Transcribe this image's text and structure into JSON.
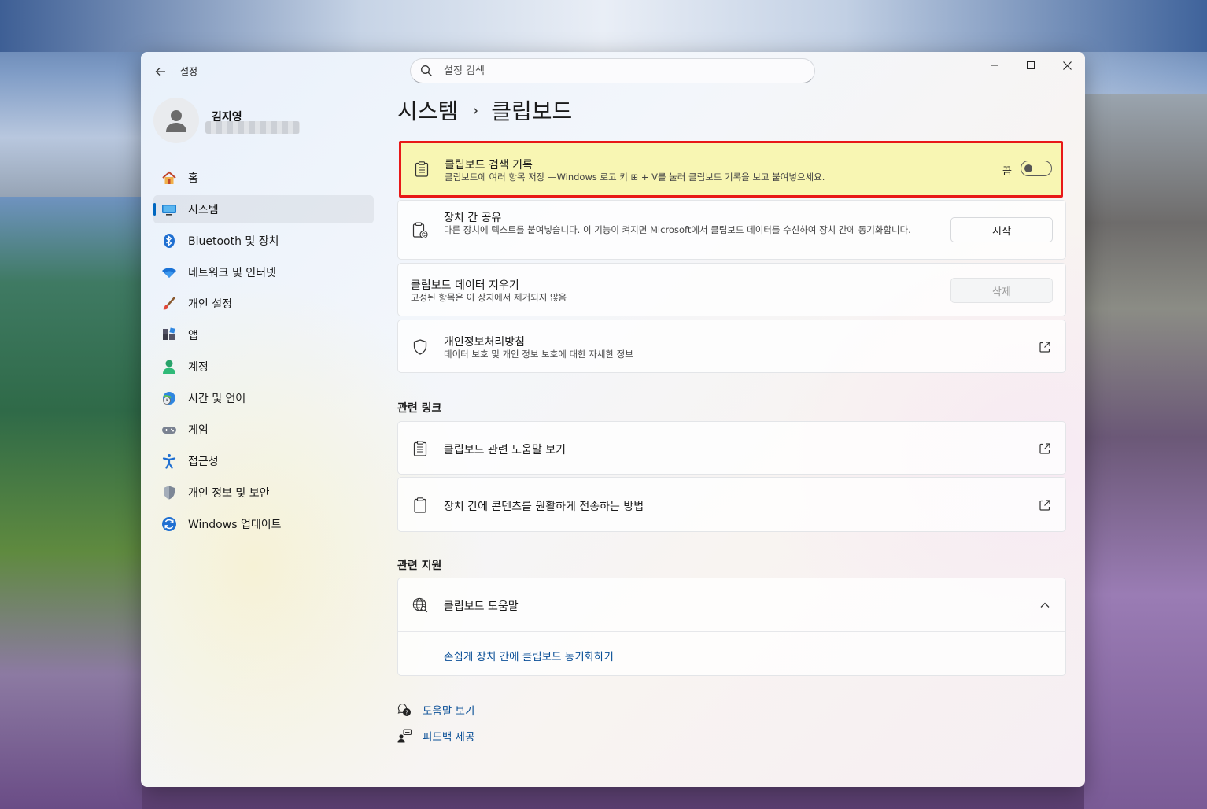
{
  "window": {
    "app_title": "설정"
  },
  "search": {
    "placeholder": "설정 검색"
  },
  "profile": {
    "name": "김지영"
  },
  "sidebar": {
    "items": [
      {
        "label": "홈",
        "icon": "home-icon"
      },
      {
        "label": "시스템",
        "icon": "system-icon",
        "active": true
      },
      {
        "label": "Bluetooth 및 장치",
        "icon": "bluetooth-icon"
      },
      {
        "label": "네트워크 및 인터넷",
        "icon": "wifi-icon"
      },
      {
        "label": "개인 설정",
        "icon": "brush-icon"
      },
      {
        "label": "앱",
        "icon": "apps-icon"
      },
      {
        "label": "계정",
        "icon": "account-icon"
      },
      {
        "label": "시간 및 언어",
        "icon": "time-language-icon"
      },
      {
        "label": "게임",
        "icon": "gamepad-icon"
      },
      {
        "label": "접근성",
        "icon": "accessibility-icon"
      },
      {
        "label": "개인 정보 및 보안",
        "icon": "shield-icon"
      },
      {
        "label": "Windows 업데이트",
        "icon": "update-icon"
      }
    ]
  },
  "breadcrumb": {
    "parent": "시스템",
    "separator": "›",
    "current": "클립보드"
  },
  "cards": {
    "history": {
      "title": "클립보드 검색 기록",
      "desc": "클립보드에 여러 항목 저장 —Windows 로고 키 ⊞ + V를 눌러 클립보드 기록을 보고 붙여넣으세요.",
      "toggle_label": "끔",
      "toggle_on": false
    },
    "share": {
      "title": "장치 간 공유",
      "desc": "다른 장치에 텍스트를 붙여넣습니다. 이 기능이 켜지면 Microsoft에서 클립보드 데이터를 수신하여 장치 간에 동기화합니다.",
      "button": "시작"
    },
    "clear": {
      "title": "클립보드 데이터 지우기",
      "desc": "고정된 항목은 이 장치에서 제거되지 않음",
      "button": "삭제"
    },
    "privacy": {
      "title": "개인정보처리방침",
      "desc": "데이터 보호 및 개인 정보 보호에 대한 자세한 정보"
    }
  },
  "related_links": {
    "heading": "관련 링크",
    "items": [
      {
        "label": "클립보드 관련 도움말 보기"
      },
      {
        "label": "장치 간에 콘텐츠를 원활하게 전송하는 방법"
      }
    ]
  },
  "related_support": {
    "heading": "관련 지원",
    "title": "클립보드 도움말",
    "link": "손쉽게 장치 간에 클립보드 동기화하기"
  },
  "footer": {
    "help": "도움말 보기",
    "feedback": "피드백 제공"
  },
  "colors": {
    "accent": "#0067c0",
    "highlight_border": "#e81818",
    "highlight_fill": "#f8f6b3",
    "link": "#0a4f97"
  }
}
